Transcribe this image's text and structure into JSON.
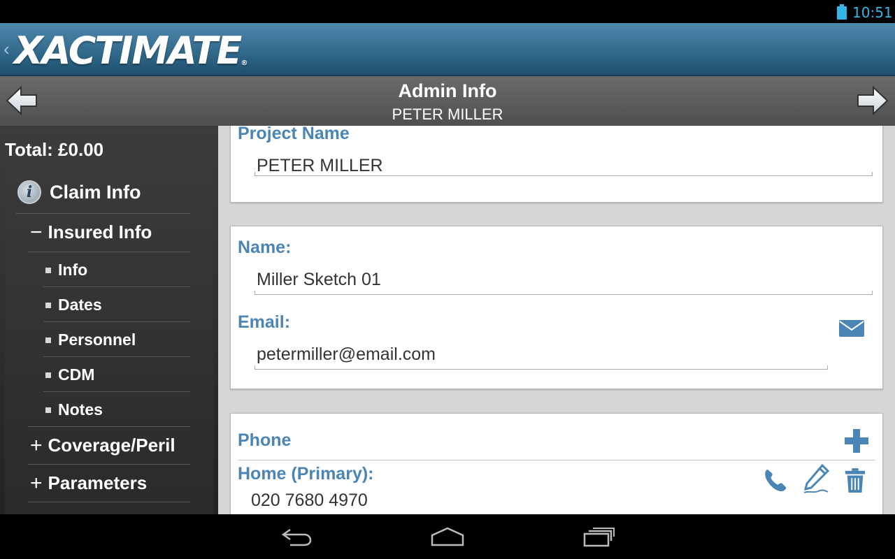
{
  "status_bar": {
    "time": "10:51"
  },
  "brand": {
    "logo_text": "XACTIMATE",
    "logo_reg": "®"
  },
  "header": {
    "title": "Admin Info",
    "subtitle": "PETER MILLER"
  },
  "sidebar": {
    "total": "Total: £0.00",
    "items": [
      {
        "label": "Claim Info",
        "kind": "section",
        "icon": "info-icon"
      },
      {
        "label": "Insured Info",
        "kind": "expanded",
        "sign": "−"
      },
      {
        "label": "Info",
        "kind": "sub"
      },
      {
        "label": "Dates",
        "kind": "sub"
      },
      {
        "label": "Personnel",
        "kind": "sub"
      },
      {
        "label": "CDM",
        "kind": "sub"
      },
      {
        "label": "Notes",
        "kind": "sub"
      },
      {
        "label": "Coverage/Peril",
        "kind": "collapsed",
        "sign": "+"
      },
      {
        "label": "Parameters",
        "kind": "collapsed",
        "sign": "+"
      }
    ]
  },
  "project": {
    "label": "Project Name",
    "value": "PETER MILLER"
  },
  "contact": {
    "name_label": "Name:",
    "name_value": "Miller Sketch 01",
    "email_label": "Email:",
    "email_value": "petermiller@email.com",
    "email_icon": "envelope-icon"
  },
  "phone": {
    "section_label": "Phone",
    "add_icon": "plus-icon",
    "entries": [
      {
        "type_label": "Home (Primary):",
        "number": "020 7680 4970"
      }
    ]
  },
  "colors": {
    "accent": "#4a85b5",
    "sidebar_bg": "#2e2e30",
    "brand_bar": "#2f6889"
  }
}
